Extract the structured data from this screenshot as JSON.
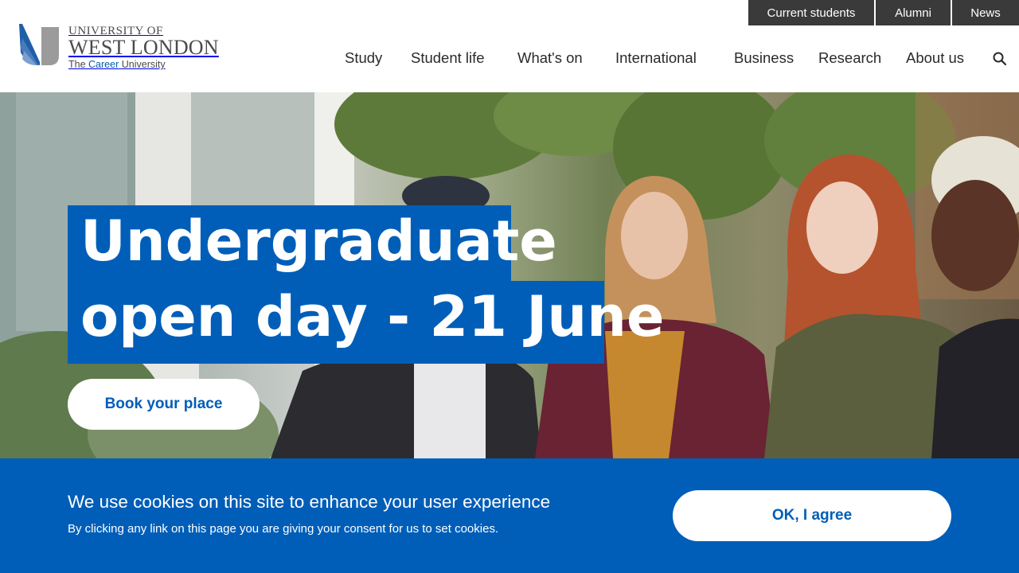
{
  "utility_nav": {
    "current_students": "Current students",
    "alumni": "Alumni",
    "news": "News"
  },
  "logo": {
    "line1": "UNIVERSITY OF",
    "line2": "WEST LONDON",
    "tagline_prefix": "The",
    "tagline_accent": "Career",
    "tagline_suffix": "University"
  },
  "main_nav": {
    "items": [
      {
        "label": "Study"
      },
      {
        "label": "Student life"
      },
      {
        "label": "What's on"
      },
      {
        "label": "International"
      },
      {
        "label": "Business"
      },
      {
        "label": "Research"
      },
      {
        "label": "About us"
      }
    ],
    "search_icon": "search-icon"
  },
  "hero": {
    "title_line1": "Undergraduate",
    "title_line2": "open day - 21 June",
    "cta": "Book your place"
  },
  "cookie_banner": {
    "heading": "We use cookies on this site to enhance your user experience",
    "text": "By clicking any link on this page you are giving your consent for us to set cookies.",
    "agree": "OK, I agree"
  },
  "colors": {
    "brand_blue": "#005eb8",
    "utility_bar": "#3a3a3a",
    "nav_text": "#2a2a2a"
  }
}
